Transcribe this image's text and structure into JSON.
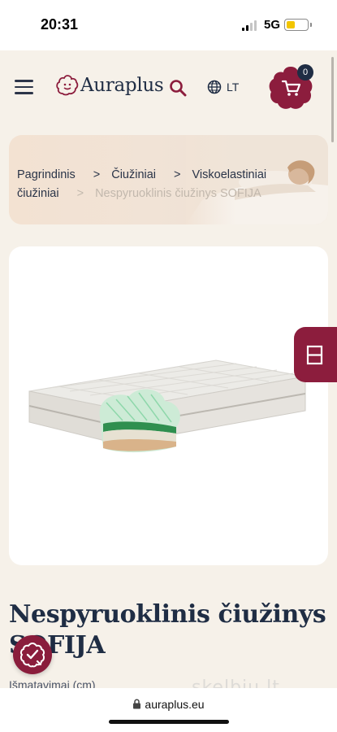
{
  "status_bar": {
    "time": "20:31",
    "network": "5G",
    "battery_level": 0.45
  },
  "header": {
    "logo_text": "Auraplus",
    "language": "LT",
    "cart_count": "0",
    "brand_color": "#8c1d3d"
  },
  "breadcrumb": {
    "items": [
      "Pagrindinis",
      "Čiužiniai",
      "Viskoelastiniai",
      "čiužiniai"
    ],
    "separator": ">",
    "current": "Nespyruoklinis čiužinys SOFIJA"
  },
  "product": {
    "title_line1": "Nespyruoklinis čiužinys",
    "title_line2": "SOFIJA",
    "dimensions_label": "Išmatavimai (cm)"
  },
  "watermark": "skelbiu.lt",
  "browser": {
    "url": "auraplus.eu"
  },
  "icons": [
    "menu-icon",
    "search-icon",
    "globe-icon",
    "cart-icon",
    "compare-icon",
    "accessibility-icon",
    "lock-icon"
  ]
}
